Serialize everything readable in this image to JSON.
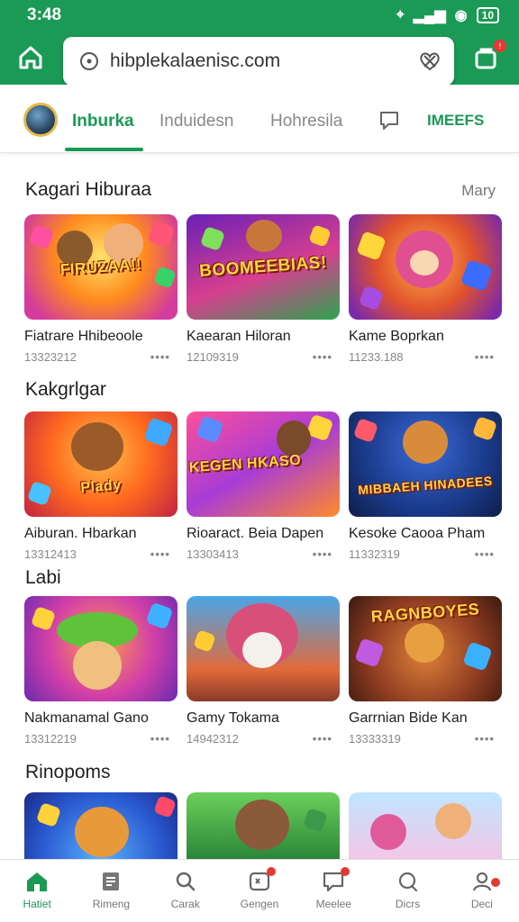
{
  "status": {
    "time": "3:48",
    "battery": "10"
  },
  "browser": {
    "url": "hibplekalaenisc.com"
  },
  "tabs": {
    "items": [
      "Inburka",
      "Induidesn",
      "Hohresila"
    ],
    "right_label": "IMEEFS"
  },
  "sections": [
    {
      "title": "Kagari Hiburaa",
      "more": "Mary",
      "cards": [
        {
          "title": "Fiatrare Hhibeoole",
          "meta": "13323212",
          "art": "FIRUZAA!!"
        },
        {
          "title": "Kaearan Hiloran",
          "meta": "12109319",
          "art": "BOOMEEBIAS!"
        },
        {
          "title": "Kame Boprkan",
          "meta": "11233.188",
          "art": ""
        }
      ]
    },
    {
      "title": "Kakgrlgar",
      "more": "",
      "cards": [
        {
          "title": "Aiburan. Hbarkan",
          "meta": "13312413",
          "art": "Plady"
        },
        {
          "title": "Rioaract. Beia Dapen",
          "meta": "13303413",
          "art": "KEGEN HKASO"
        },
        {
          "title": "Kesoke Caooa Pham",
          "meta": "11332319",
          "art": "MIBBAEH HINADEES"
        }
      ]
    },
    {
      "title": "Labi",
      "more": "",
      "cards": [
        {
          "title": "Nakmanamal Gano",
          "meta": "13312219",
          "art": ""
        },
        {
          "title": "Gamy Tokama",
          "meta": "14942312",
          "art": ""
        },
        {
          "title": "Garrnian Bide Kan",
          "meta": "13333319",
          "art": "RAGNBOYES"
        }
      ]
    },
    {
      "title": "Rinopoms",
      "more": "",
      "cards": [
        {
          "title": "",
          "meta": "",
          "art": ""
        },
        {
          "title": "",
          "meta": "",
          "art": ""
        },
        {
          "title": "",
          "meta": "",
          "art": ""
        }
      ]
    }
  ],
  "bottom_nav": [
    "Hatiet",
    "Rimeng",
    "Carak",
    "Gengen",
    "Meelee",
    "Dicrs",
    "Deci"
  ],
  "colors": {
    "accent": "#1b9a55",
    "badge": "#e53935"
  }
}
